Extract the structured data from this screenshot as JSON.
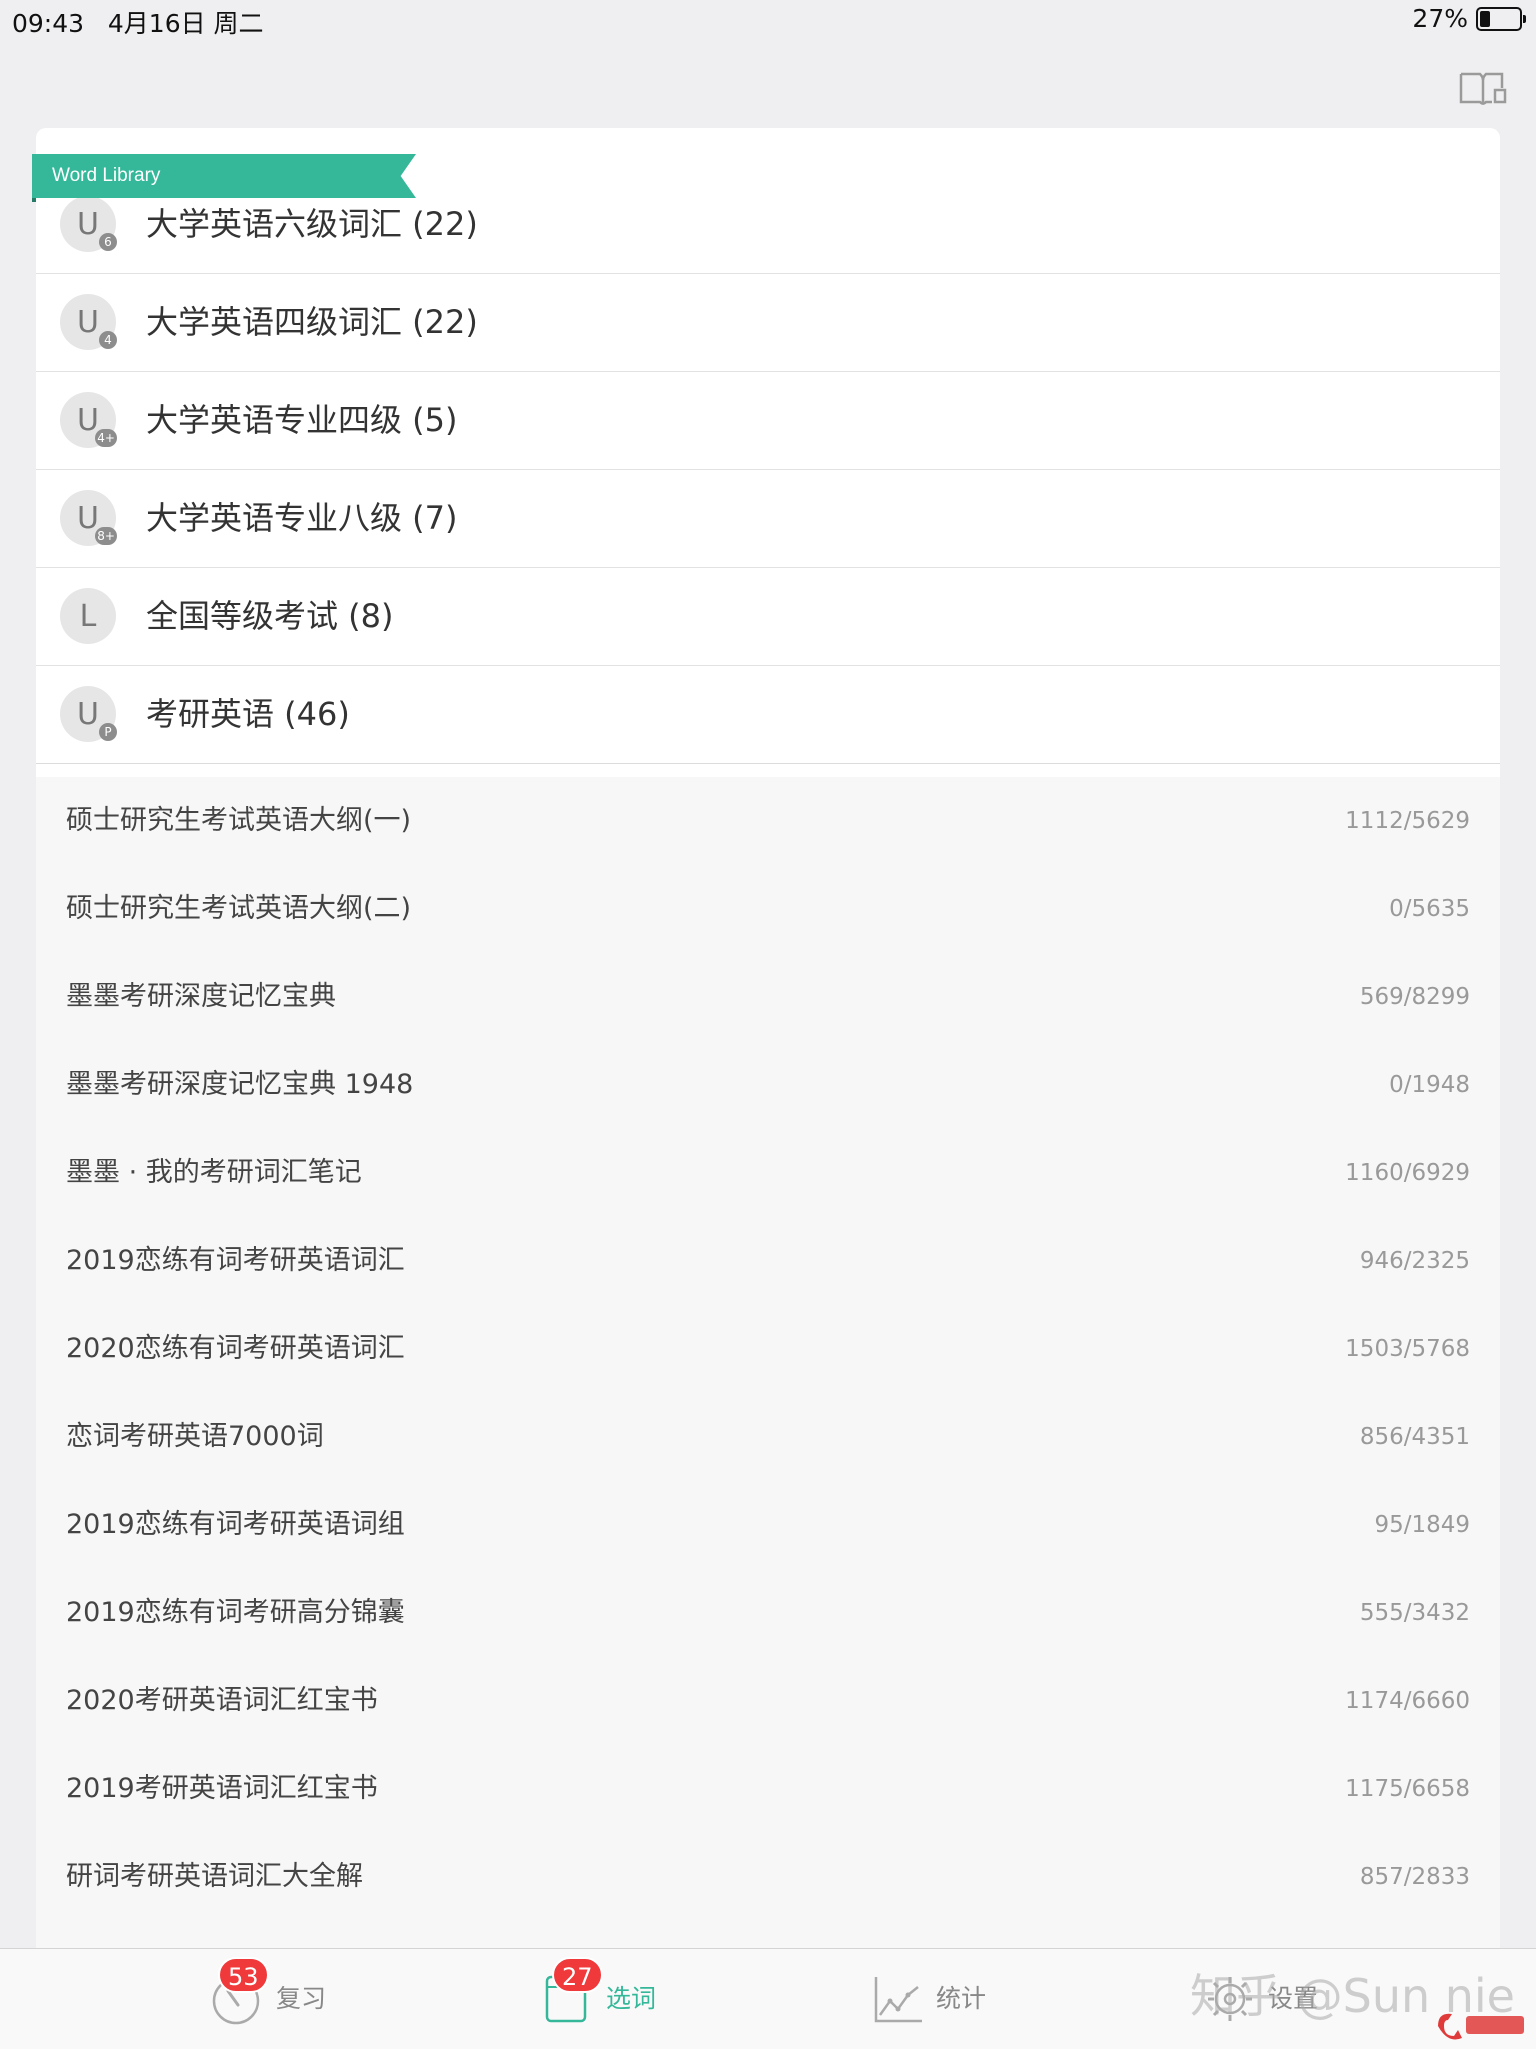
{
  "status_bar": {
    "time": "09:43",
    "date": "4月16日 周二",
    "battery_percent": "27%",
    "battery_level": 0.27
  },
  "ribbon": {
    "label": "Word Library"
  },
  "categories": [
    {
      "letter": "U",
      "badge": "6",
      "label": "大学英语六级词汇 (22)"
    },
    {
      "letter": "U",
      "badge": "4",
      "label": "大学英语四级词汇 (22)"
    },
    {
      "letter": "U",
      "badge": "4+",
      "label": "大学英语专业四级 (5)"
    },
    {
      "letter": "U",
      "badge": "8+",
      "label": "大学英语专业八级 (7)"
    },
    {
      "letter": "L",
      "badge": "",
      "label": "全国等级考试 (8)"
    },
    {
      "letter": "U",
      "badge": "P",
      "label": "考研英语 (46)"
    }
  ],
  "books": [
    {
      "name": "硕士研究生考试英语大纲(一)",
      "count": "1112/5629"
    },
    {
      "name": "硕士研究生考试英语大纲(二)",
      "count": "0/5635"
    },
    {
      "name": "墨墨考研深度记忆宝典",
      "count": "569/8299"
    },
    {
      "name": "墨墨考研深度记忆宝典 1948",
      "count": "0/1948"
    },
    {
      "name": "墨墨 · 我的考研词汇笔记",
      "count": "1160/6929"
    },
    {
      "name": "2019恋练有词考研英语词汇",
      "count": "946/2325"
    },
    {
      "name": "2020恋练有词考研英语词汇",
      "count": "1503/5768"
    },
    {
      "name": "恋词考研英语7000词",
      "count": "856/4351"
    },
    {
      "name": "2019恋练有词考研英语词组",
      "count": "95/1849"
    },
    {
      "name": "2019恋练有词考研高分锦囊",
      "count": "555/3432"
    },
    {
      "name": "2020考研英语词汇红宝书",
      "count": "1174/6660"
    },
    {
      "name": "2019考研英语词汇红宝书",
      "count": "1175/6658"
    },
    {
      "name": "研词考研英语词汇大全解",
      "count": "857/2833"
    }
  ],
  "tabs": [
    {
      "label": "复习",
      "badge": "53",
      "icon": "review-icon"
    },
    {
      "label": "选词",
      "badge": "27",
      "icon": "notebook-icon",
      "active": true
    },
    {
      "label": "统计",
      "badge": "",
      "icon": "chart-icon"
    },
    {
      "label": "设置",
      "badge": "",
      "icon": "gear-icon"
    }
  ],
  "watermark": "知乎 @Sun nie",
  "colors": {
    "accent": "#35b899",
    "badge": "#f0393b",
    "background": "#efeff1"
  }
}
